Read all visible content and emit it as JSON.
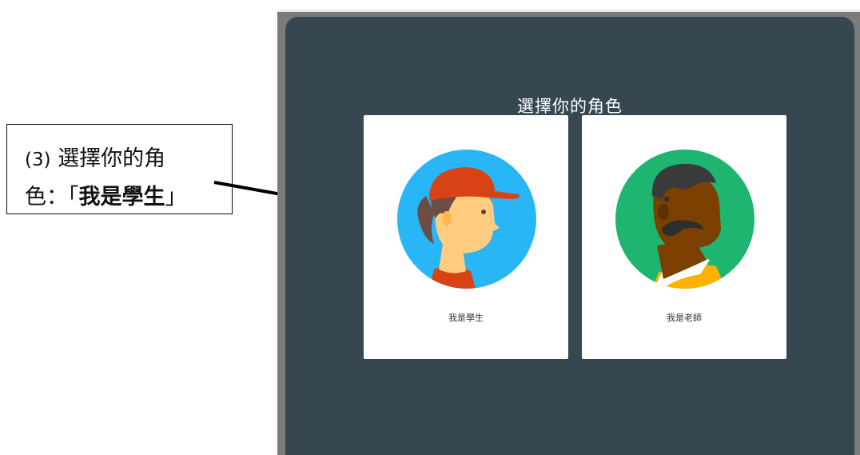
{
  "callout": {
    "number": "(3)",
    "line1_text": "選擇你的角",
    "line2_prefix": "色：「",
    "line2_bold": "我是學生",
    "line2_suffix": "」"
  },
  "dialog": {
    "title": "選擇你的角色",
    "background_color": "#37474f"
  },
  "roles": [
    {
      "label": "我是學生",
      "icon": "student-avatar-icon",
      "circle_color": "#29b6f6"
    },
    {
      "label": "我是老師",
      "icon": "teacher-avatar-icon",
      "circle_color": "#1db56f"
    }
  ]
}
